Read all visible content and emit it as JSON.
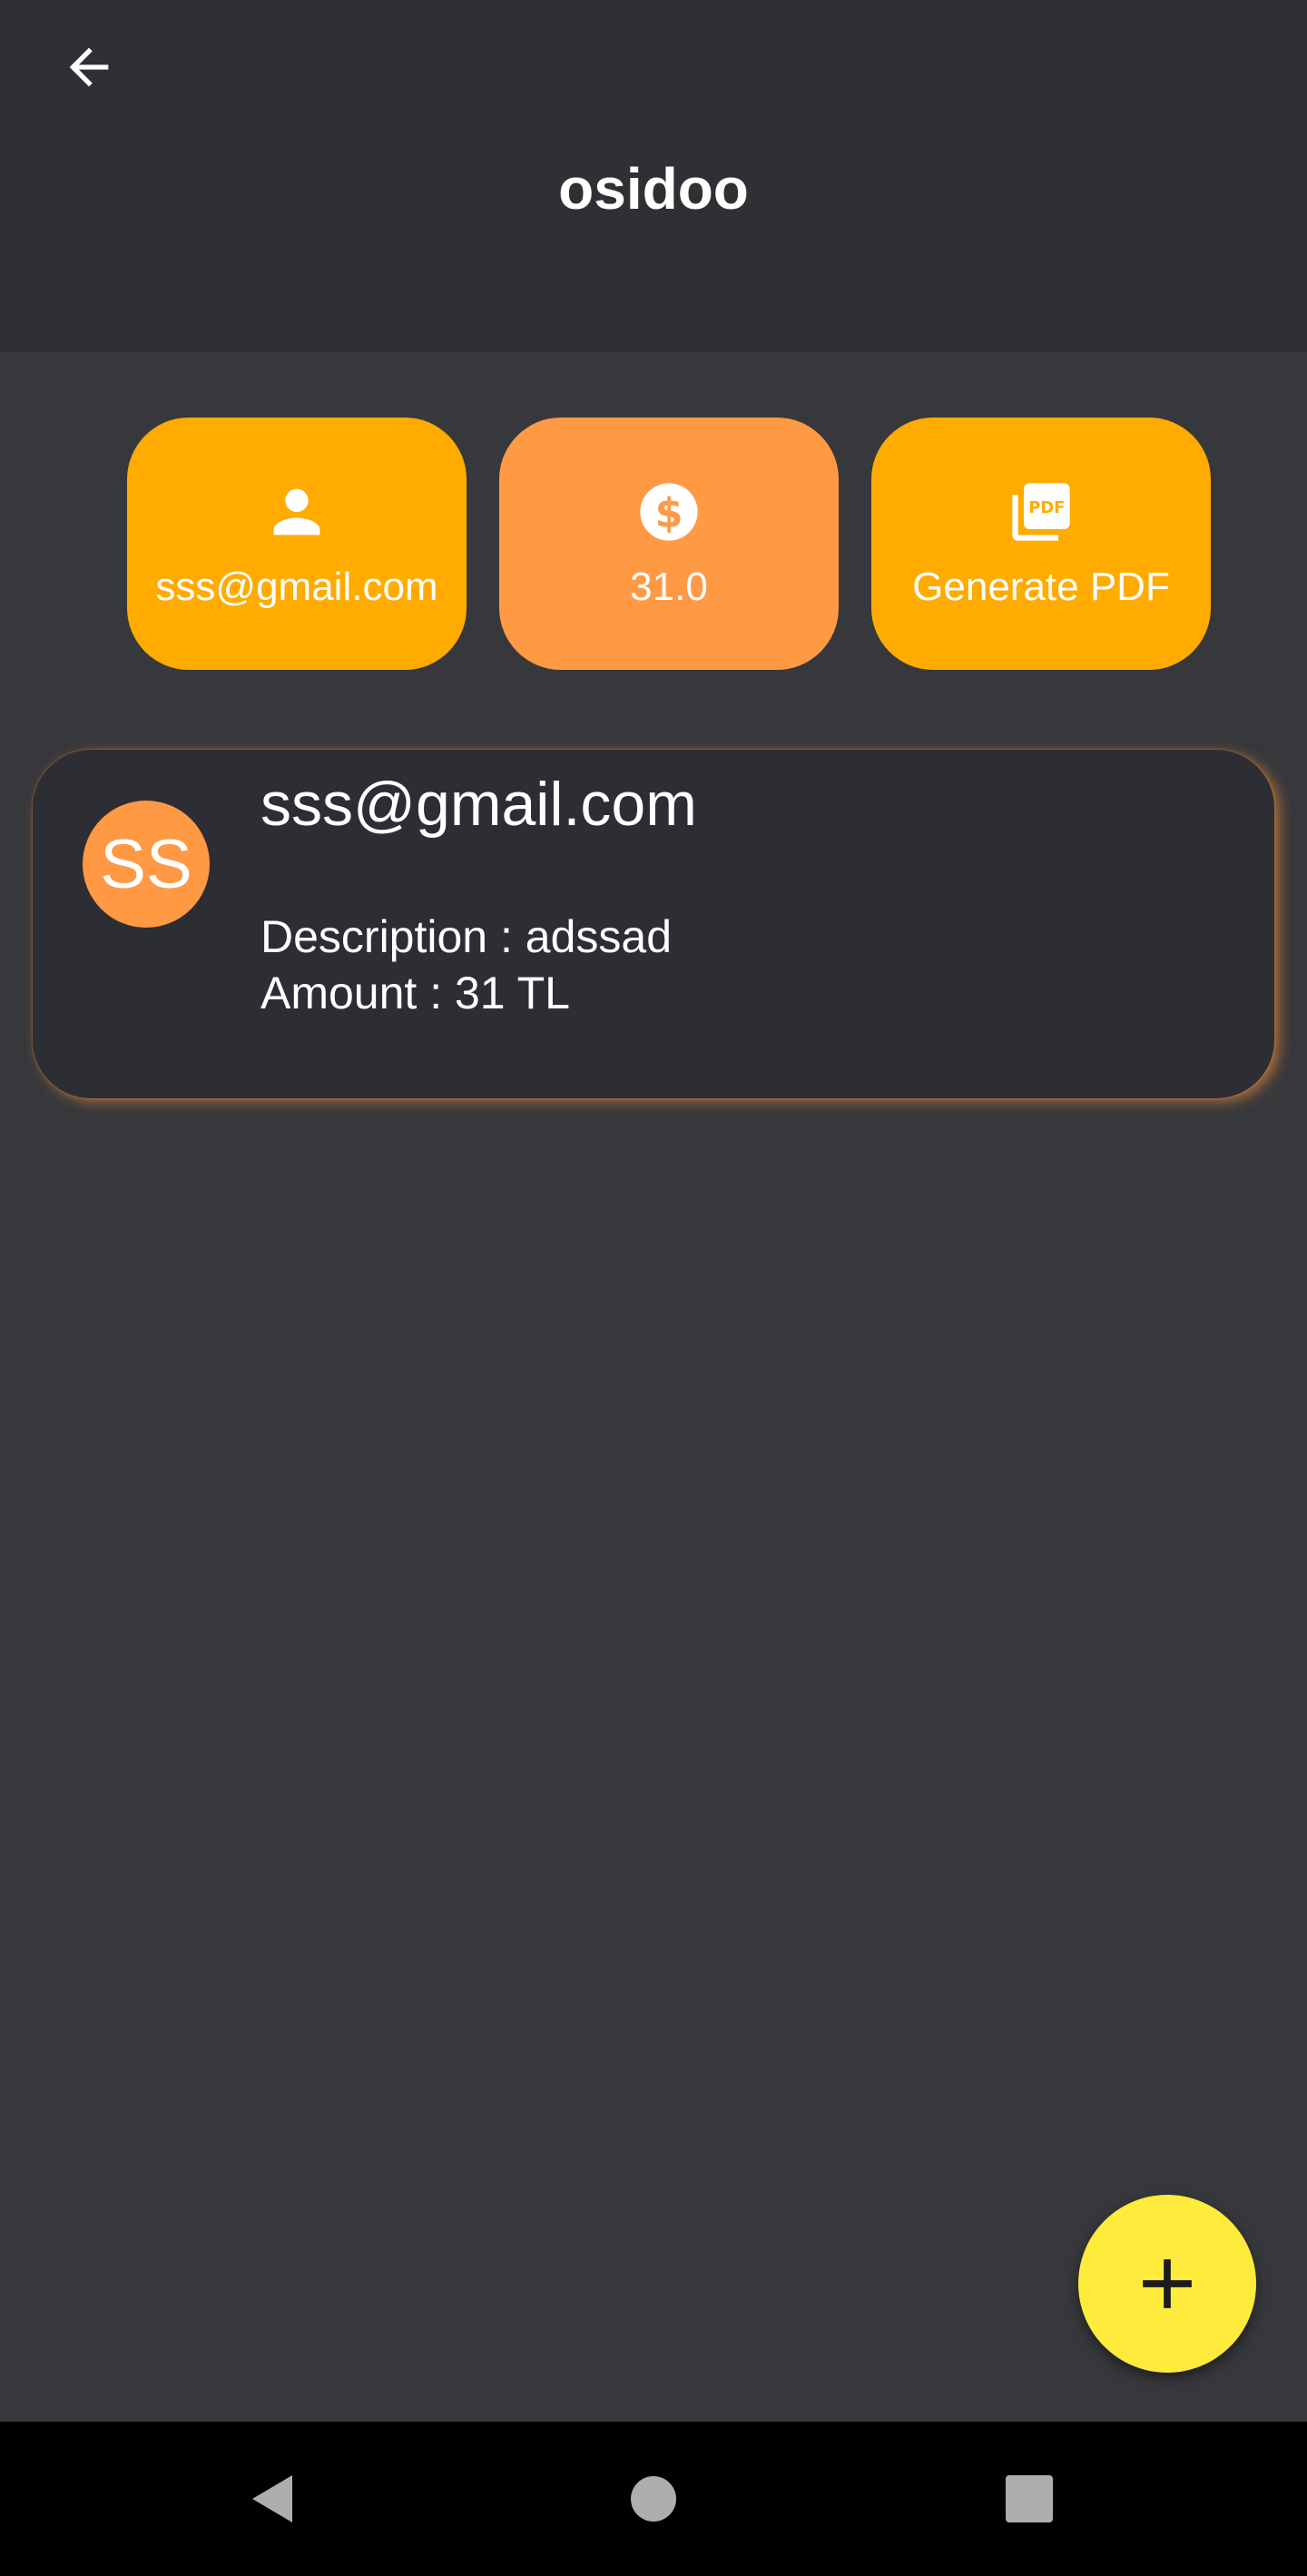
{
  "appbar": {
    "title": "osidoo",
    "back_icon": "arrow-left-icon"
  },
  "tiles": [
    {
      "label": "sss@gmail.com",
      "icon": "person-icon",
      "color": "#ffab00"
    },
    {
      "label": "31.0",
      "icon": "dollar-circle-icon",
      "color": "#ff9944"
    },
    {
      "label": "Generate PDF",
      "icon": "pdf-icon",
      "color": "#ffab00"
    }
  ],
  "entry": {
    "avatar_initials": "SS",
    "email": "sss@gmail.com",
    "description_label": "Description : ",
    "description_value": "adssad",
    "amount_label": "Amount : ",
    "amount_value": "31 TL"
  },
  "fab": {
    "icon": "plus-icon",
    "color": "#ffeb3b"
  },
  "nav": {
    "back_icon": "triangle-back-icon",
    "home_icon": "circle-home-icon",
    "recents_icon": "square-recents-icon"
  },
  "colors": {
    "background": "#37383c",
    "appbar": "#2f3034",
    "accent_orange": "#ff9944",
    "accent_amber": "#ffab00"
  }
}
